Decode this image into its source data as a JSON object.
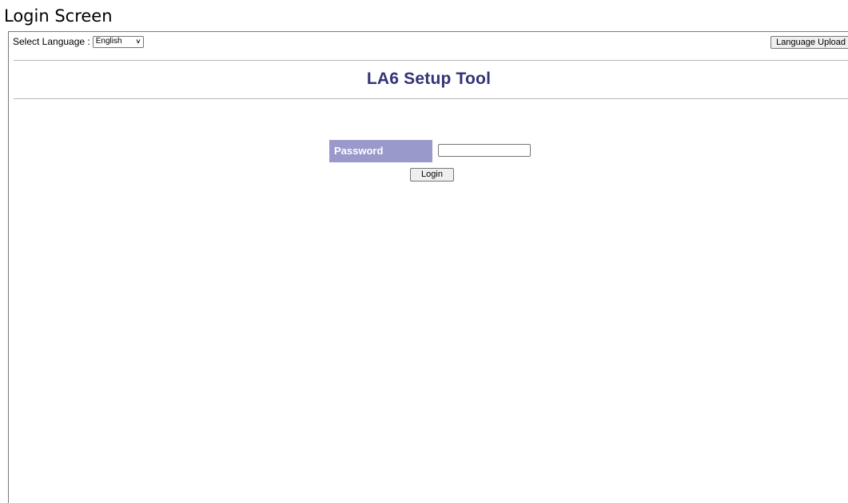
{
  "caption": "Login Screen",
  "header": {
    "language_label": "Select Language :",
    "language_selected": "English",
    "language_upload_label": "Language Upload"
  },
  "app": {
    "title": "LA6 Setup Tool"
  },
  "login_form": {
    "password_label": "Password",
    "password_value": "",
    "login_label": "Login"
  },
  "colors": {
    "title": "#333377",
    "label_bg": "#9999cc"
  },
  "icons": {
    "select_arrow": "chevron-down-icon"
  }
}
